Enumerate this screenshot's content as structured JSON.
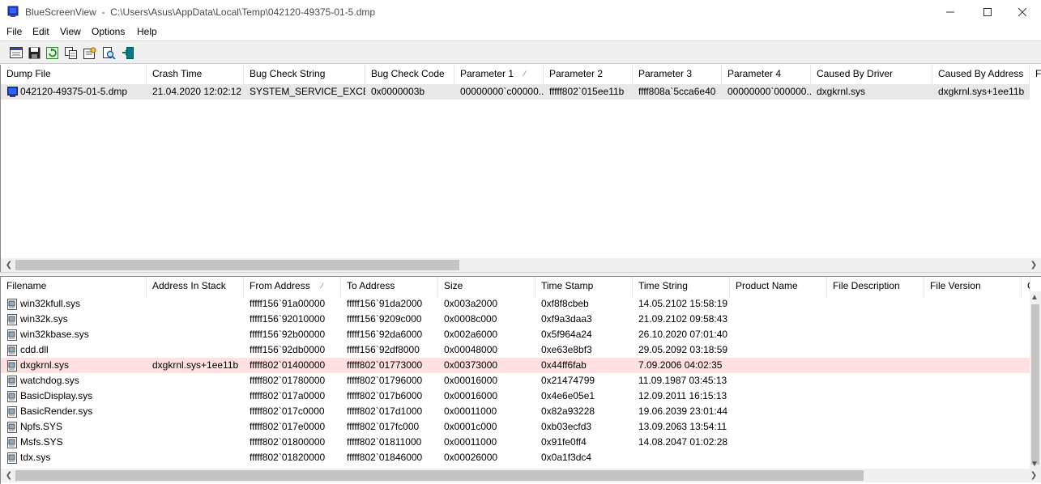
{
  "window": {
    "app_name": "BlueScreenView",
    "path": "C:\\Users\\Asus\\AppData\\Local\\Temp\\042120-49375-01-5.dmp"
  },
  "menu": [
    "File",
    "Edit",
    "View",
    "Options",
    "Help"
  ],
  "toolbar": [
    "properties-icon",
    "save-icon",
    "refresh-icon",
    "copy-icon",
    "options-icon",
    "find-icon",
    "exit-icon"
  ],
  "dump_list": {
    "columns": [
      "Dump File",
      "Crash Time",
      "Bug Check String",
      "Bug Check Code",
      "Parameter 1",
      "Parameter 2",
      "Parameter 3",
      "Parameter 4",
      "Caused By Driver",
      "Caused By Address",
      "F"
    ],
    "rows": [
      [
        "042120-49375-01-5.dmp",
        "21.04.2020 12:02:12",
        "SYSTEM_SERVICE_EXCEP...",
        "0x0000003b",
        "00000000`c00000...",
        "fffff802`015ee11b",
        "ffff808a`5cca6e40",
        "00000000`000000...",
        "dxgkrnl.sys",
        "dxgkrnl.sys+1ee11b"
      ]
    ]
  },
  "driver_list": {
    "columns": [
      "Filename",
      "Address In Stack",
      "From Address",
      "To Address",
      "Size",
      "Time Stamp",
      "Time String",
      "Product Name",
      "File Description",
      "File Version",
      "C"
    ],
    "rows": [
      [
        "win32kfull.sys",
        "",
        "fffff156`91a00000",
        "fffff156`91da2000",
        "0x003a2000",
        "0xf8f8cbeb",
        "14.05.2102 15:58:19"
      ],
      [
        "win32k.sys",
        "",
        "fffff156`92010000",
        "fffff156`9209c000",
        "0x0008c000",
        "0xf9a3daa3",
        "21.09.2102 09:58:43"
      ],
      [
        "win32kbase.sys",
        "",
        "fffff156`92b00000",
        "fffff156`92da6000",
        "0x002a6000",
        "0x5f964a24",
        "26.10.2020 07:01:40"
      ],
      [
        "cdd.dll",
        "",
        "fffff156`92db0000",
        "fffff156`92df8000",
        "0x00048000",
        "0xe63e8bf3",
        "29.05.2092 03:18:59"
      ],
      [
        "dxgkrnl.sys",
        "dxgkrnl.sys+1ee11b",
        "fffff802`01400000",
        "fffff802`01773000",
        "0x00373000",
        "0x44ff6fab",
        "7.09.2006 04:02:35"
      ],
      [
        "watchdog.sys",
        "",
        "fffff802`01780000",
        "fffff802`01796000",
        "0x00016000",
        "0x21474799",
        "11.09.1987 03:45:13"
      ],
      [
        "BasicDisplay.sys",
        "",
        "fffff802`017a0000",
        "fffff802`017b6000",
        "0x00016000",
        "0x4e6e05e1",
        "12.09.2011 16:15:13"
      ],
      [
        "BasicRender.sys",
        "",
        "fffff802`017c0000",
        "fffff802`017d1000",
        "0x00011000",
        "0x82a93228",
        "19.06.2039 23:01:44"
      ],
      [
        "Npfs.SYS",
        "",
        "fffff802`017e0000",
        "fffff802`017fc000",
        "0x0001c000",
        "0xb03ecfd3",
        "13.09.2063 13:54:11"
      ],
      [
        "Msfs.SYS",
        "",
        "fffff802`01800000",
        "fffff802`01811000",
        "0x00011000",
        "0x91fe0ff4",
        "14.08.2047 01:02:28"
      ],
      [
        "tdx.sys",
        "",
        "fffff802`01820000",
        "fffff802`01846000",
        "0x00026000",
        "0x0a1f3dc4",
        ""
      ]
    ]
  },
  "colors": {
    "highlight_row": "#ffe0e0",
    "selected_row": "#e8e8e8"
  }
}
